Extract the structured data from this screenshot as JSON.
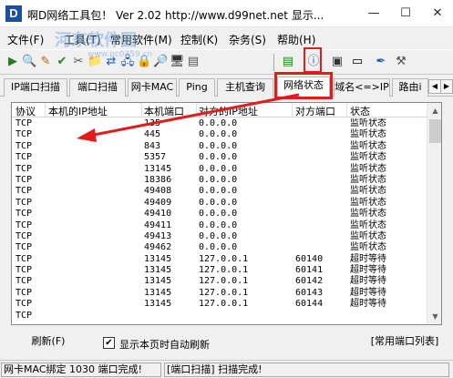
{
  "window": {
    "title": "啊D网络工具包！ Ver 2.02   http://www.d99net.net  显示...",
    "icon_letter": "D",
    "controls": {
      "minimize": "—",
      "maximize": "☐",
      "close": "✕"
    }
  },
  "watermark": {
    "text": "河东软件园",
    "sub": "www.pc0359.cn"
  },
  "menu": [
    "文件(F)",
    "工具(T)",
    "常用软件(M)",
    "控制(K)",
    "杂务(S)",
    "帮助(H)"
  ],
  "toolbar": {
    "icons": [
      "start-icon",
      "search-icon",
      "pin-icon",
      "check-icon",
      "wrench-icon",
      "folder-icon",
      "share-icon",
      "network-icon",
      "lock-icon",
      "magnifier-icon",
      "computer-icon",
      "chip-icon",
      "info-icon",
      "monitor-icon",
      "terminal-icon",
      "pen-icon",
      "tools-icon"
    ],
    "glyphs": [
      "▶",
      "🔍",
      "✎",
      "✔",
      "✂",
      "📁",
      "⇄",
      "🖧",
      "🔒",
      "🔎",
      "🖥",
      "▤",
      "ⓘ",
      "▣",
      "▭",
      "✒",
      "⚒"
    ]
  },
  "tabs": [
    {
      "label": "IP端口扫描",
      "active": false
    },
    {
      "label": "端口扫描",
      "active": false
    },
    {
      "label": "网卡MAC",
      "active": false
    },
    {
      "label": "Ping",
      "active": false
    },
    {
      "label": "主机查询",
      "active": false
    },
    {
      "label": "网络状态",
      "active": true
    },
    {
      "label": "域名<=>IP",
      "active": false
    },
    {
      "label": "路由i",
      "active": false
    }
  ],
  "tab_scroll": {
    "left": "◀",
    "right": "▶"
  },
  "table": {
    "headers": {
      "protocol": "协议",
      "local_ip": "本机的IP地址",
      "local_port": "本机端口",
      "remote_ip": "对方的IP地址",
      "remote_port": "对方端口",
      "state": "状态"
    },
    "rows": [
      {
        "protocol": "TCP",
        "local_port": "135",
        "remote_ip": "0.0.0.0",
        "remote_port": "",
        "state": "监听状态"
      },
      {
        "protocol": "TCP",
        "local_port": "445",
        "remote_ip": "0.0.0.0",
        "remote_port": "",
        "state": "监听状态"
      },
      {
        "protocol": "TCP",
        "local_port": "843",
        "remote_ip": "0.0.0.0",
        "remote_port": "",
        "state": "监听状态"
      },
      {
        "protocol": "TCP",
        "local_port": "5357",
        "remote_ip": "0.0.0.0",
        "remote_port": "",
        "state": "监听状态"
      },
      {
        "protocol": "TCP",
        "local_port": "13145",
        "remote_ip": "0.0.0.0",
        "remote_port": "",
        "state": "监听状态"
      },
      {
        "protocol": "TCP",
        "local_port": "18386",
        "remote_ip": "0.0.0.0",
        "remote_port": "",
        "state": "监听状态"
      },
      {
        "protocol": "TCP",
        "local_port": "49408",
        "remote_ip": "0.0.0.0",
        "remote_port": "",
        "state": "监听状态"
      },
      {
        "protocol": "TCP",
        "local_port": "49409",
        "remote_ip": "0.0.0.0",
        "remote_port": "",
        "state": "监听状态"
      },
      {
        "protocol": "TCP",
        "local_port": "49410",
        "remote_ip": "0.0.0.0",
        "remote_port": "",
        "state": "监听状态"
      },
      {
        "protocol": "TCP",
        "local_port": "49411",
        "remote_ip": "0.0.0.0",
        "remote_port": "",
        "state": "监听状态"
      },
      {
        "protocol": "TCP",
        "local_port": "49413",
        "remote_ip": "0.0.0.0",
        "remote_port": "",
        "state": "监听状态"
      },
      {
        "protocol": "TCP",
        "local_port": "49462",
        "remote_ip": "0.0.0.0",
        "remote_port": "",
        "state": "监听状态"
      },
      {
        "protocol": "TCP",
        "local_port": "13145",
        "remote_ip": "127.0.0.1",
        "remote_port": "60140",
        "state": "超时等待"
      },
      {
        "protocol": "TCP",
        "local_port": "13145",
        "remote_ip": "127.0.0.1",
        "remote_port": "60141",
        "state": "超时等待"
      },
      {
        "protocol": "TCP",
        "local_port": "13145",
        "remote_ip": "127.0.0.1",
        "remote_port": "60142",
        "state": "超时等待"
      },
      {
        "protocol": "TCP",
        "local_port": "13145",
        "remote_ip": "127.0.0.1",
        "remote_port": "60143",
        "state": "超时等待"
      },
      {
        "protocol": "TCP",
        "local_port": "13145",
        "remote_ip": "127.0.0.1",
        "remote_port": "60144",
        "state": "超时等待"
      },
      {
        "protocol": "TCP",
        "local_port": "",
        "remote_ip": "",
        "remote_port": "",
        "state": ""
      }
    ]
  },
  "scroll": {
    "up": "▲",
    "down": "▼"
  },
  "bottom": {
    "refresh_label": "刷新(F)",
    "auto_refresh_label": "显示本页时自动刷新",
    "auto_refresh_checked": true,
    "check_mark": "✔",
    "ports_label": "[常用端口列表]"
  },
  "status": {
    "left": "网卡MAC绑定 1030 端口完成!",
    "right": "[端口扫描] 扫描完成!"
  },
  "colors": {
    "highlight": "#e21b1b",
    "arrow": "#e21b1b",
    "title_icon": "#1a4fa3"
  }
}
